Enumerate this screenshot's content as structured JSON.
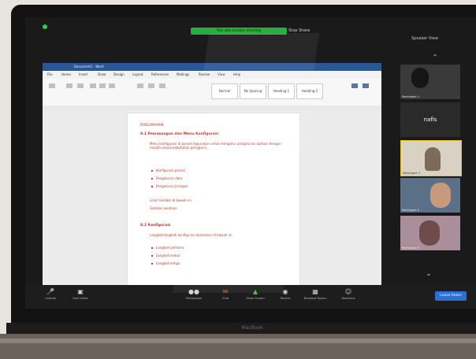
{
  "laptop": {
    "brand": "MacBook"
  },
  "meeting": {
    "share_banner": "You are screen sharing",
    "stop_share": "Stop Share",
    "view_options": "Speaker View"
  },
  "document": {
    "title": "Document1 - Word",
    "ribbon_tabs": [
      "File",
      "Home",
      "Insert",
      "Draw",
      "Design",
      "Layout",
      "References",
      "Mailings",
      "Review",
      "View",
      "Help"
    ],
    "styles": [
      "Normal",
      "No Spacing",
      "Heading 1",
      "Heading 2"
    ],
    "section_label": "PENGUMUMAN",
    "heading_1": "8.1 Pemasangan dan Menu Konfigurasi",
    "paragraph_1": "Menu konfigurasi di ponsel digunakan untuk mengatur pengaturan aplikasi dengan mudah sesuai kebutuhan pengguna.",
    "bullets_1": [
      "Konfigurasi ponsel",
      "Pengaturan data",
      "Pengaturan jaringan"
    ],
    "note_1": "Lihat Gambar di bawah ini",
    "note_2": "Gambar panduan",
    "heading_2": "8.2 Konfigurasi",
    "paragraph_2": "Langkah-langkah konfigurasi dijelaskan di bawah ini.",
    "bullets_2": [
      "Langkah pertama",
      "Langkah kedua",
      "Langkah ketiga"
    ]
  },
  "gallery": {
    "tiles": [
      {
        "name": "Participant 1",
        "type": "video"
      },
      {
        "name": "nafis",
        "type": "name-only"
      },
      {
        "name": "Participant 3",
        "type": "video"
      },
      {
        "name": "Participant 4",
        "type": "video"
      },
      {
        "name": "Participant 5",
        "type": "video"
      }
    ]
  },
  "toolbar": {
    "items": [
      {
        "label": "Unmute",
        "icon": "microphone-icon"
      },
      {
        "label": "Start Video",
        "icon": "video-camera-icon"
      },
      {
        "label": "Participants",
        "icon": "participants-icon"
      },
      {
        "label": "Chat",
        "icon": "chat-icon"
      },
      {
        "label": "Share Screen",
        "icon": "share-screen-icon"
      },
      {
        "label": "Record",
        "icon": "record-icon"
      },
      {
        "label": "Breakout Rooms",
        "icon": "breakout-rooms-icon"
      },
      {
        "label": "Reactions",
        "icon": "reactions-icon"
      }
    ],
    "leave_label": "Leave Room"
  },
  "colors": {
    "accent": "#2d6fd6",
    "doc_text": "#c0392b",
    "share_green": "#27ae3b"
  }
}
